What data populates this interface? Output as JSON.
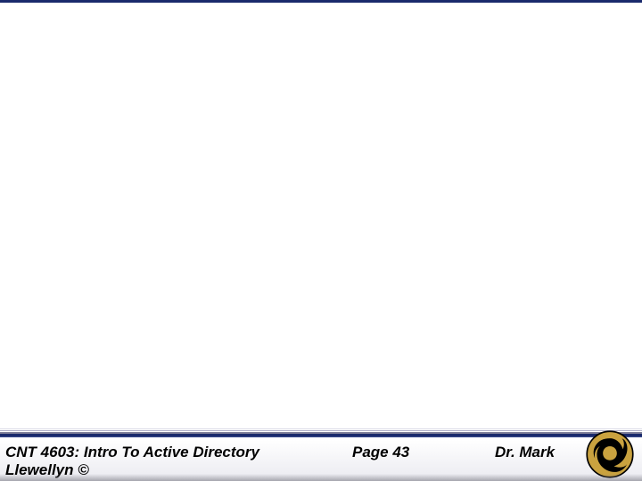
{
  "slide": {
    "course_title": "CNT 4603: Intro To Active Directory",
    "author_line2": "Llewellyn ©",
    "page_label": "Page 43",
    "author": "Dr. Mark"
  },
  "logo": {
    "name": "pegasus-logo",
    "fill": "#c9a23f",
    "stroke": "#000000"
  }
}
